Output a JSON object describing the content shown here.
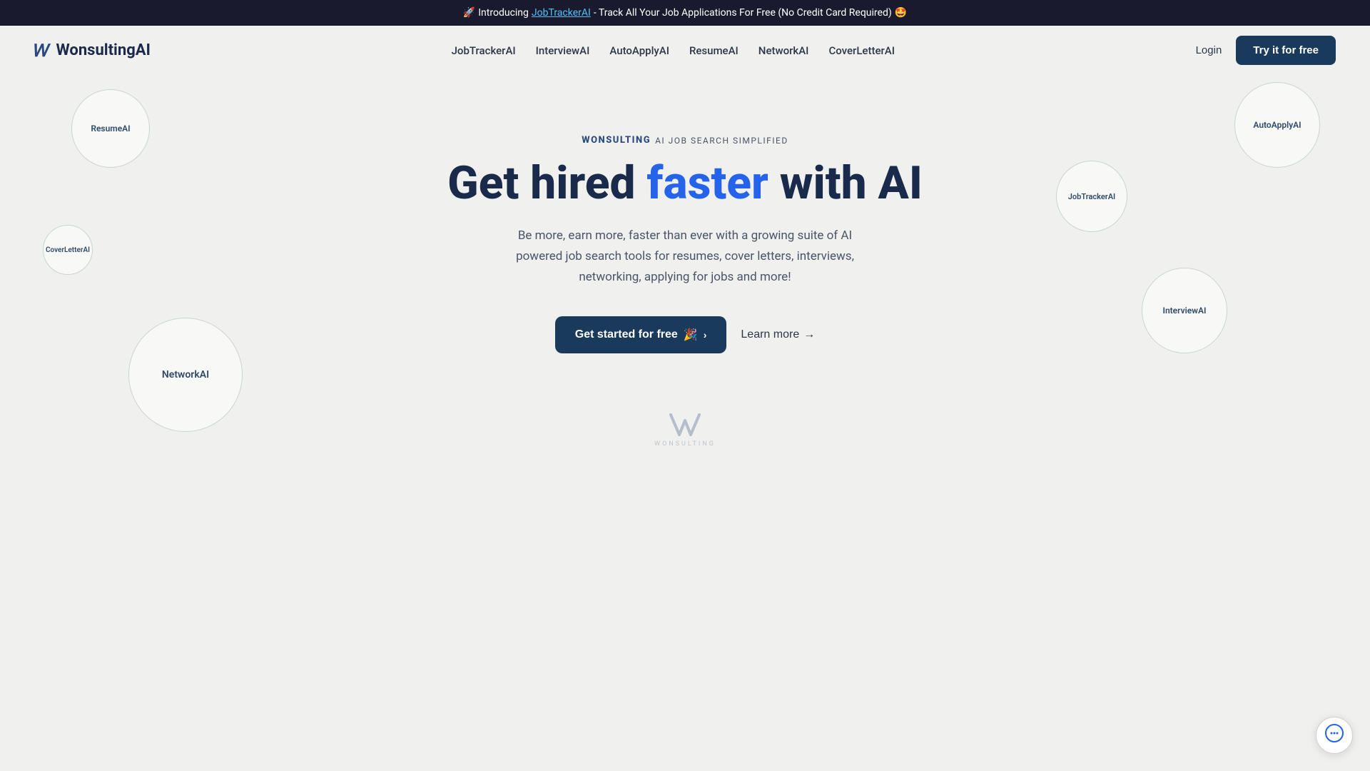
{
  "banner": {
    "emoji_rocket": "🚀",
    "text_intro": "Introducing ",
    "link_text": "JobTrackerAI",
    "text_rest": " - Track All Your Job Applications For Free (No Credit Card Required)",
    "emoji_star": "🤩"
  },
  "navbar": {
    "logo_text": "WonsultingAI",
    "logo_w": "W",
    "links": [
      {
        "label": "JobTrackerAI",
        "id": "nav-jobtrackerai"
      },
      {
        "label": "InterviewAI",
        "id": "nav-interviewai"
      },
      {
        "label": "AutoApplyAI",
        "id": "nav-autoapplyai"
      },
      {
        "label": "ResumeAI",
        "id": "nav-resumeai"
      },
      {
        "label": "NetworkAI",
        "id": "nav-networkai"
      },
      {
        "label": "CoverLetterAI",
        "id": "nav-coverletterai"
      }
    ],
    "login_label": "Login",
    "try_free_label": "Try it for free"
  },
  "hero": {
    "badge_logo": "Wonsulting",
    "badge_text": "AI JOB SEARCH SIMPLIFIED",
    "title_part1": "Get hired ",
    "title_highlight": "faster",
    "title_part2": " with AI",
    "description": "Be more, earn more, faster than ever with a growing suite of AI powered job search tools for resumes, cover letters, interviews, networking, applying for jobs and more!",
    "cta_primary": "Get started for free",
    "cta_primary_emoji": "🎉",
    "cta_secondary": "Learn more",
    "arrow": "→"
  },
  "floating_circles": [
    {
      "label": "ResumeAI",
      "class": "circle-resumeai"
    },
    {
      "label": "AutoApplyAI",
      "class": "circle-autoapplyai"
    },
    {
      "label": "JobTrackerAI",
      "class": "circle-jobtrackerai"
    },
    {
      "label": "CoverLetterAI",
      "class": "circle-coverletterai"
    },
    {
      "label": "NetworkAI",
      "class": "circle-networkai"
    },
    {
      "label": "InterviewAI",
      "class": "circle-interviewai"
    }
  ],
  "bottom_logo": {
    "symbol": "W",
    "wordmark": "WONSULTING"
  },
  "chat_button": {
    "icon": "💬"
  }
}
